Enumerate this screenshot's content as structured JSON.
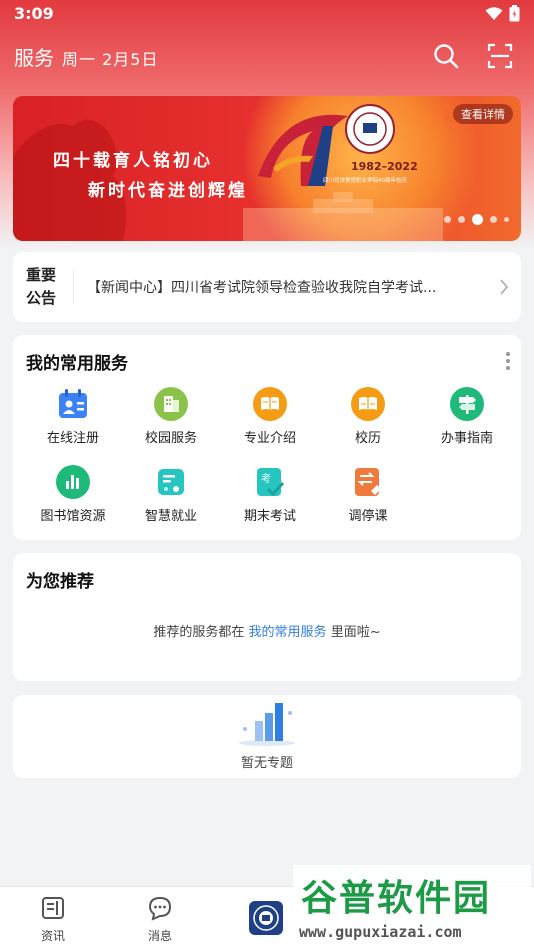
{
  "status": {
    "time": "3:09"
  },
  "header": {
    "title": "服务",
    "date": "周一 2月5日"
  },
  "banner": {
    "slogan_line1": "四十载育人铭初心",
    "slogan_line2": "新时代奋进创辉煌",
    "detail_label": "查看详情",
    "years": "1982–2022",
    "sub": "四川司法警官职业学院40周年校庆"
  },
  "notice": {
    "tag": "重要公告",
    "text": "【新闻中心】四川省考试院领导检查验收我院自学考试..."
  },
  "services": {
    "title": "我的常用服务",
    "items": [
      {
        "label": "在线注册",
        "icon": "calendar-user-icon",
        "color": "#3b82f6"
      },
      {
        "label": "校园服务",
        "icon": "building-icon",
        "color": "#8bc34a"
      },
      {
        "label": "专业介绍",
        "icon": "book-icon",
        "color": "#f59b14"
      },
      {
        "label": "校历",
        "icon": "book-open-icon",
        "color": "#f59b14"
      },
      {
        "label": "办事指南",
        "icon": "signpost-icon",
        "color": "#1fba7a"
      },
      {
        "label": "图书馆资源",
        "icon": "chart-bars-icon",
        "color": "#1fba7a"
      },
      {
        "label": "智慧就业",
        "icon": "career-doc-icon",
        "color": "#26c6c0"
      },
      {
        "label": "期末考试",
        "icon": "exam-check-icon",
        "color": "#26c6c0"
      },
      {
        "label": "调停课",
        "icon": "swap-doc-icon",
        "color": "#f07a3c"
      }
    ]
  },
  "recommend": {
    "title": "为您推荐",
    "text_before": "推荐的服务都在",
    "link": "我的常用服务",
    "text_after": "里面啦~"
  },
  "topics": {
    "empty_text": "暂无专题"
  },
  "tabs": [
    {
      "label": "资讯",
      "icon": "news-icon"
    },
    {
      "label": "消息",
      "icon": "message-icon"
    },
    {
      "label": "",
      "icon": "school-logo-icon"
    }
  ],
  "watermark": {
    "main": "谷普软件园",
    "sub": "www.gupuxiazai.com"
  },
  "colors": {
    "primary_red": "#e23a3f",
    "link_blue": "#2f7fe0"
  }
}
